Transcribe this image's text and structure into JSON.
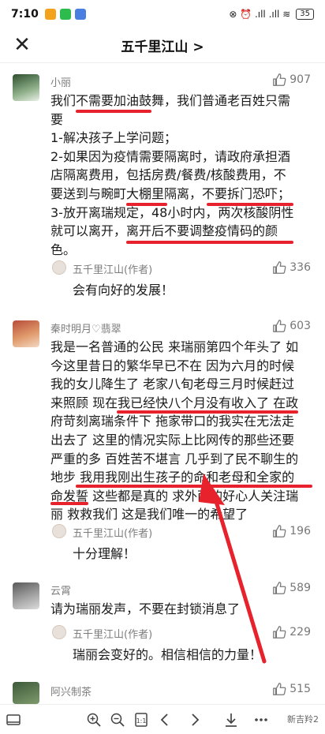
{
  "status_bar": {
    "time": "7:10",
    "indicators": "⊗ ⏰ .ıll .ıll ≋",
    "battery": "35"
  },
  "nav": {
    "title": "五千里江山 >"
  },
  "comments": [
    {
      "author": "小丽",
      "likes": "907",
      "lines": [
        "我们不需要加油鼓舞，我们普通老百姓只需",
        "要",
        "1-解决孩子上学问题；",
        "2-如果因为疫情需要隔离时，请政府承担酒",
        "店隔离费用，包括房费/餐费/核酸费用，不",
        "要送到与畹町大棚里隔离，不要拆门恐吓；",
        "3-放开离瑞规定，48小时内，两次核酸阴性",
        "就可以离开，离开后不要调整疫情码的颜",
        "色。"
      ],
      "reply": {
        "author": "五千里江山(作者)",
        "likes": "336",
        "text": "会有向好的发展！"
      }
    },
    {
      "author": "秦时明月♡翡翠",
      "likes": "603",
      "lines": [
        "我是一名普通的公民 来瑞丽第四个年头了 如",
        "今这里昔日的繁华早已不在 因为六月的时候",
        "我的女儿降生了 老家八旬老母三月时候赶过",
        "来照顾 现在我已经快八个月没有收入了 在政",
        "府苛刻离瑞条件下 拖家带口的我实在无法走",
        "出去了 这里的情况实际上比网传的那些还要",
        "严重的多 百姓苦不堪言 几乎到了民不聊生的",
        "地步 我用我刚出生孩子的命和老母和全家的",
        "命发誓 这些都是真的 求外面的好心人关注瑞",
        "丽 救救我们 这是我们唯一的希望了"
      ],
      "reply": {
        "author": "五千里江山(作者)",
        "likes": "196",
        "text": "十分理解！"
      }
    },
    {
      "author": "云霄",
      "likes": "589",
      "lines": [
        "请为瑞丽发声，不要在封锁消息了"
      ],
      "reply": {
        "author": "五千里江山(作者)",
        "likes": "229",
        "text": "瑞丽会变好的。相信相信的力量！"
      }
    },
    {
      "author": "阿兴制茶",
      "likes": "515",
      "lines": []
    }
  ],
  "bottom_bar": {
    "watermark": "新吉羚2",
    "icons": [
      "window-icon",
      "zoom-in-icon",
      "zoom-out-icon",
      "page-icon",
      "prev-page-icon",
      "next-page-icon",
      "download-icon",
      "more-icon"
    ]
  },
  "colors": {
    "underline": "#e7222d",
    "meta_text": "#7d7d7d"
  }
}
